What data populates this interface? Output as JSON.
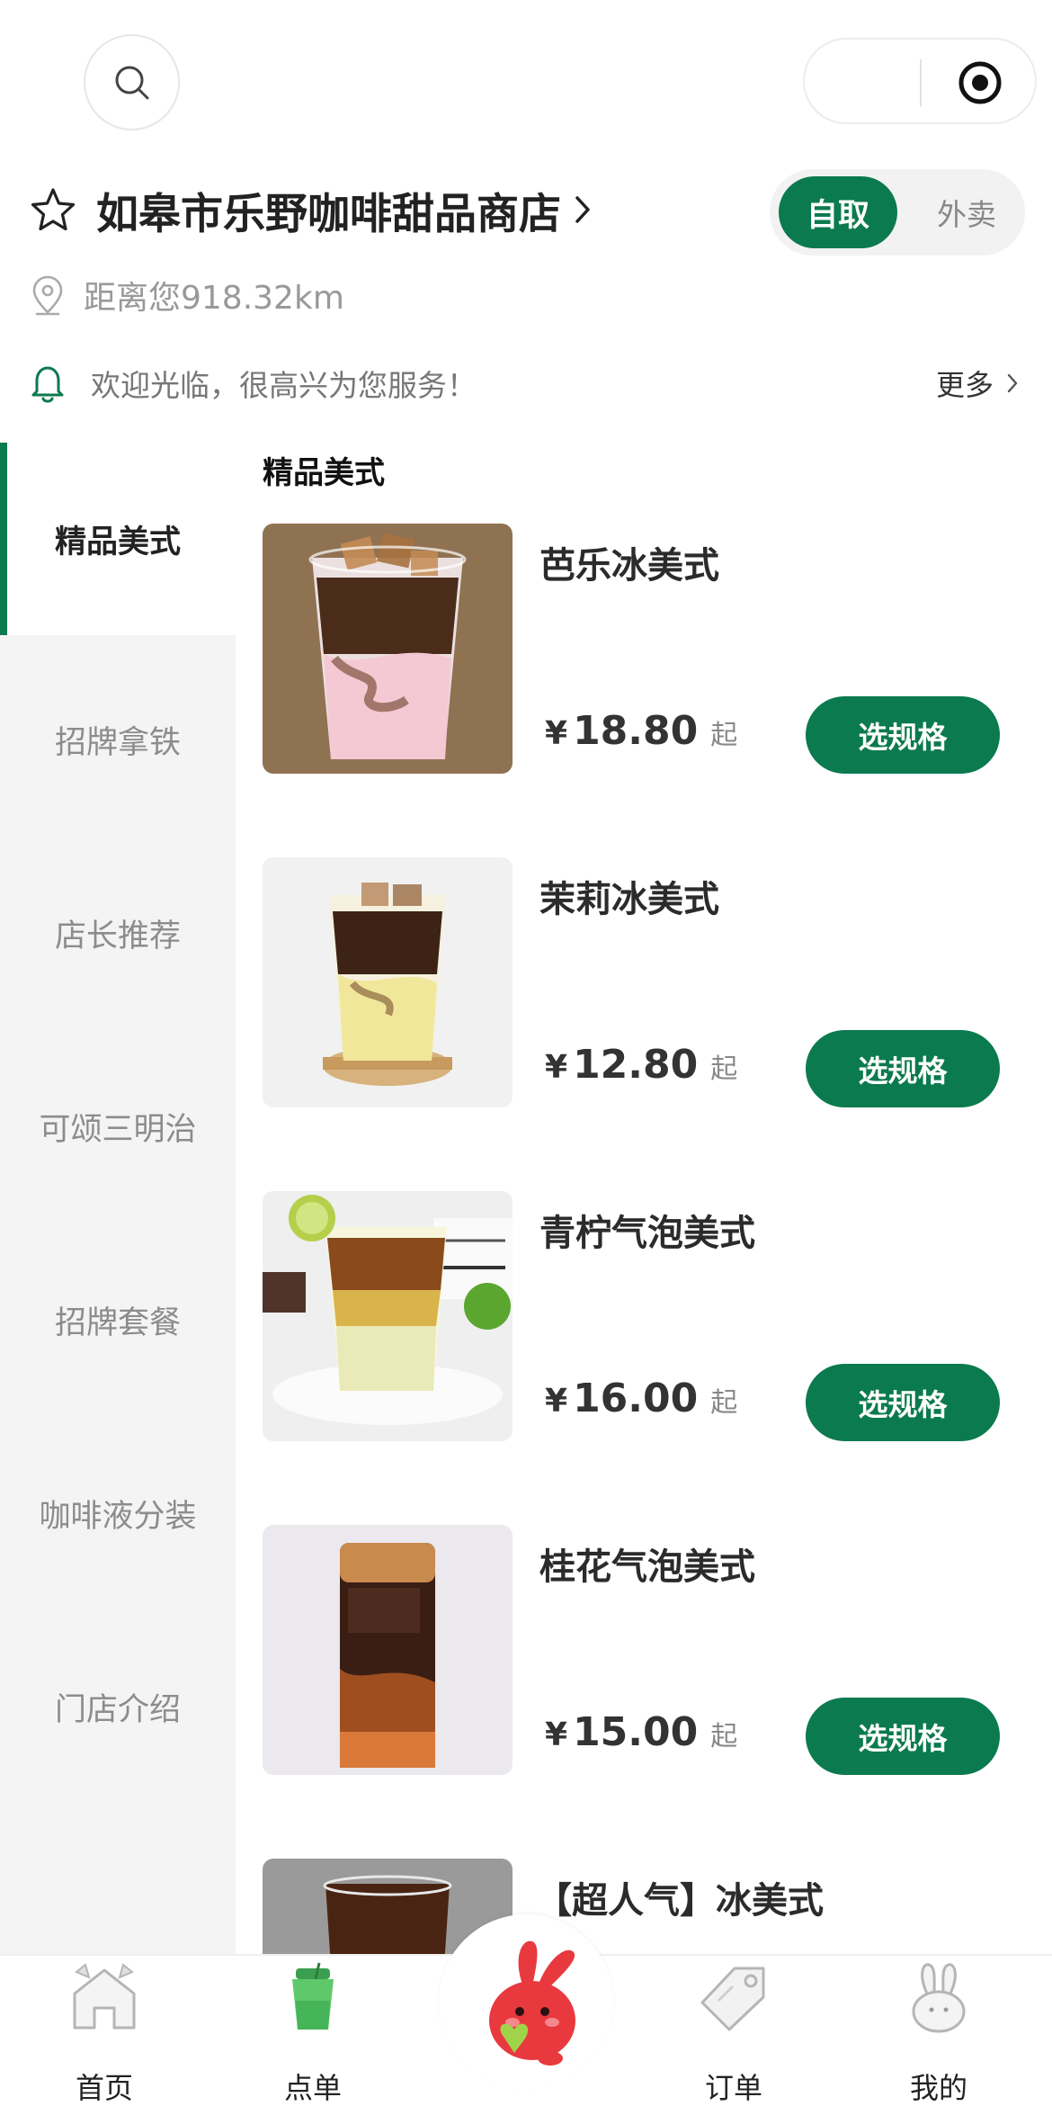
{
  "store": {
    "name": "如皋市乐野咖啡甜品商店",
    "distance": "距离您918.32km",
    "notice": "欢迎光临，很高兴为您服务！",
    "more_label": "更多"
  },
  "mode_toggle": {
    "selected": "自取",
    "other": "外卖"
  },
  "colors": {
    "brand": "#0b7a4f",
    "muted": "#999999",
    "sidebar_bg": "#f4f4f4"
  },
  "sidebar": {
    "items": [
      {
        "label": "精品美式",
        "active": true
      },
      {
        "label": "招牌拿铁"
      },
      {
        "label": "店长推荐"
      },
      {
        "label": "可颂三明治"
      },
      {
        "label": "招牌套餐"
      },
      {
        "label": "咖啡液分装"
      },
      {
        "label": "门店介绍"
      }
    ]
  },
  "menu": {
    "section_title": "精品美式",
    "products": [
      {
        "name": "芭乐冰美式",
        "currency": "¥",
        "price": "18.80",
        "suffix": "起",
        "button": "选规格"
      },
      {
        "name": "茉莉冰美式",
        "currency": "¥",
        "price": "12.80",
        "suffix": "起",
        "button": "选规格"
      },
      {
        "name": "青柠气泡美式",
        "currency": "¥",
        "price": "16.00",
        "suffix": "起",
        "button": "选规格"
      },
      {
        "name": "桂花气泡美式",
        "currency": "¥",
        "price": "15.00",
        "suffix": "起",
        "button": "选规格"
      },
      {
        "name": "【超人气】冰美式"
      }
    ]
  },
  "tabbar": {
    "items": [
      {
        "label": "首页",
        "icon": "home-icon"
      },
      {
        "label": "点单",
        "icon": "order-cup-icon",
        "active": true
      },
      {
        "label": "",
        "icon": "mascot-rabbit-icon"
      },
      {
        "label": "订单",
        "icon": "tag-icon"
      },
      {
        "label": "我的",
        "icon": "rabbit-icon"
      }
    ]
  }
}
